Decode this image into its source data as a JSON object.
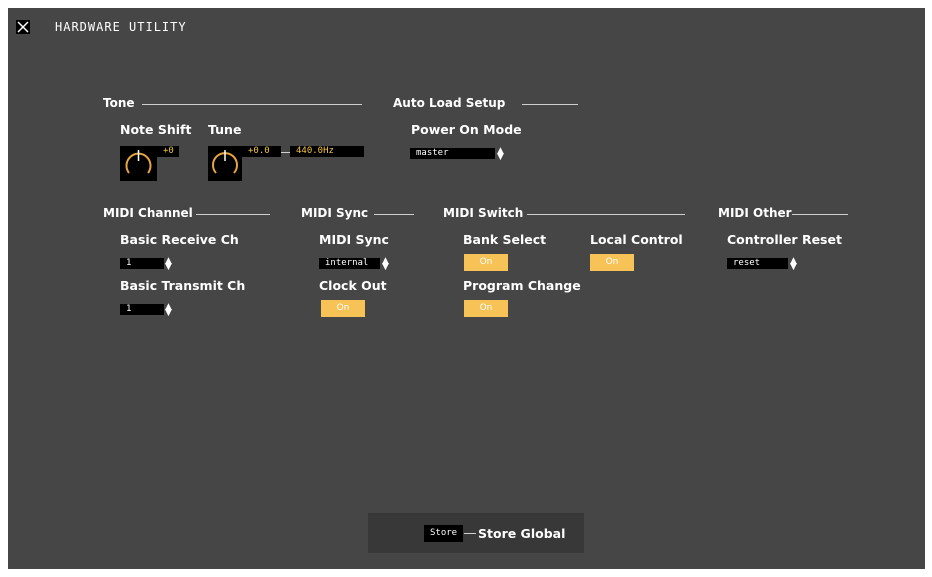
{
  "title": "HARDWARE UTILITY",
  "colors": {
    "background": "#464646",
    "accent": "#f7c256",
    "value_text": "#f4c542"
  },
  "icons": {
    "close": "close-x-icon",
    "knob": "rotary-knob-icon",
    "spin": "up-down-spin-icon"
  },
  "tone": {
    "heading": "Tone",
    "note_shift": {
      "label": "Note Shift",
      "value": "+0"
    },
    "tune": {
      "label": "Tune",
      "value": "+0.0",
      "hz": "440.0Hz"
    }
  },
  "auto_load": {
    "heading": "Auto Load Setup",
    "power_on_mode": {
      "label": "Power On Mode",
      "value": "master"
    }
  },
  "midi_channel": {
    "heading": "MIDI Channel",
    "basic_receive": {
      "label": "Basic Receive Ch",
      "value": "1"
    },
    "basic_transmit": {
      "label": "Basic Transmit Ch",
      "value": "1"
    }
  },
  "midi_sync": {
    "heading": "MIDI Sync",
    "sync": {
      "label": "MIDI Sync",
      "value": "internal"
    },
    "clock_out": {
      "label": "Clock Out",
      "value": "On"
    }
  },
  "midi_switch": {
    "heading": "MIDI Switch",
    "bank_select": {
      "label": "Bank Select",
      "value": "On"
    },
    "local_control": {
      "label": "Local Control",
      "value": "On"
    },
    "program_change": {
      "label": "Program Change",
      "value": "On"
    }
  },
  "midi_other": {
    "heading": "MIDI Other",
    "controller_reset": {
      "label": "Controller Reset",
      "value": "reset"
    }
  },
  "store": {
    "button": "Store",
    "label": "Store Global"
  }
}
